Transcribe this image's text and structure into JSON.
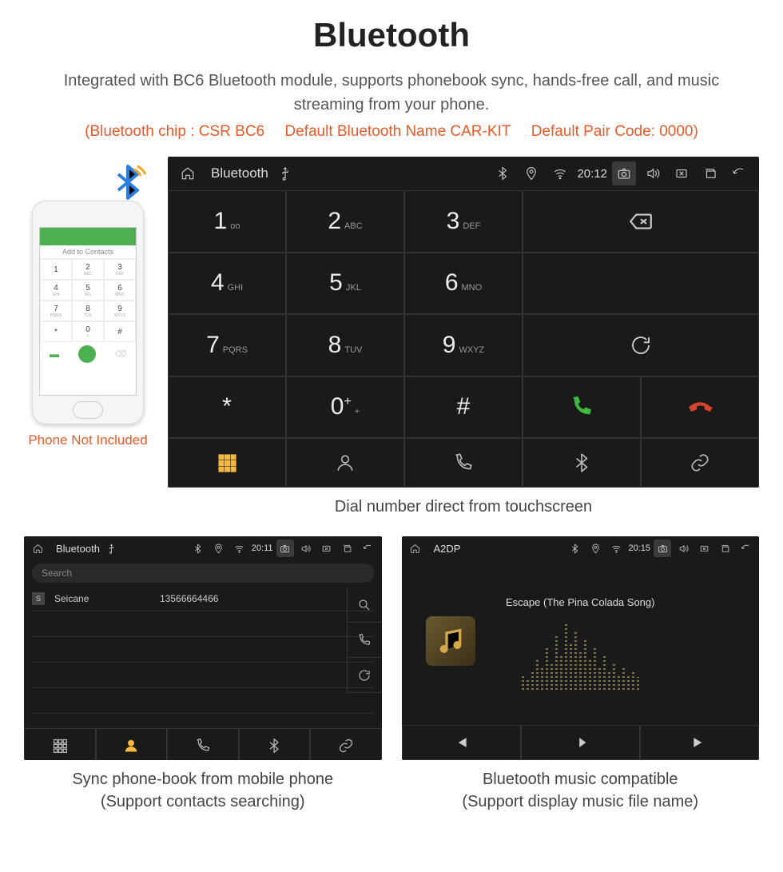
{
  "header": {
    "title": "Bluetooth",
    "subtitle": "Integrated with BC6 Bluetooth module, supports phonebook sync, hands-free call, and music streaming from your phone.",
    "spec_chip": "(Bluetooth chip : CSR BC6",
    "spec_name": "Default Bluetooth Name CAR-KIT",
    "spec_code": "Default Pair Code: 0000)"
  },
  "phone": {
    "caption": "Phone Not Included",
    "add_contacts": "Add to Contacts",
    "keys": [
      {
        "n": "1",
        "l": ""
      },
      {
        "n": "2",
        "l": "ABC"
      },
      {
        "n": "3",
        "l": "DEF"
      },
      {
        "n": "4",
        "l": "GHI"
      },
      {
        "n": "5",
        "l": "JKL"
      },
      {
        "n": "6",
        "l": "MNO"
      },
      {
        "n": "7",
        "l": "PQRS"
      },
      {
        "n": "8",
        "l": "TUV"
      },
      {
        "n": "9",
        "l": "WXYZ"
      },
      {
        "n": "*",
        "l": ""
      },
      {
        "n": "0",
        "l": "+"
      },
      {
        "n": "#",
        "l": ""
      }
    ]
  },
  "dialer": {
    "statusbar": {
      "title": "Bluetooth",
      "time": "20:12"
    },
    "keys": [
      {
        "n": "1",
        "l": "oo"
      },
      {
        "n": "2",
        "l": "ABC"
      },
      {
        "n": "3",
        "l": "DEF"
      },
      {
        "n": "4",
        "l": "GHI"
      },
      {
        "n": "5",
        "l": "JKL"
      },
      {
        "n": "6",
        "l": "MNO"
      },
      {
        "n": "7",
        "l": "PQRS"
      },
      {
        "n": "8",
        "l": "TUV"
      },
      {
        "n": "9",
        "l": "WXYZ"
      },
      {
        "n": "*",
        "l": ""
      },
      {
        "n": "0",
        "l": "+",
        "sup": "+"
      },
      {
        "n": "#",
        "l": ""
      }
    ],
    "caption": "Dial number direct from touchscreen"
  },
  "phonebook": {
    "statusbar": {
      "title": "Bluetooth",
      "time": "20:11"
    },
    "search_placeholder": "Search",
    "contacts": [
      {
        "badge": "S",
        "name": "Seicane",
        "number": "13566664466"
      }
    ],
    "caption_l1": "Sync phone-book from mobile phone",
    "caption_l2": "(Support contacts searching)"
  },
  "music": {
    "statusbar": {
      "title": "A2DP",
      "time": "20:15"
    },
    "song": "Escape (The Pina Colada Song)",
    "caption_l1": "Bluetooth music compatible",
    "caption_l2": "(Support display music file name)"
  }
}
